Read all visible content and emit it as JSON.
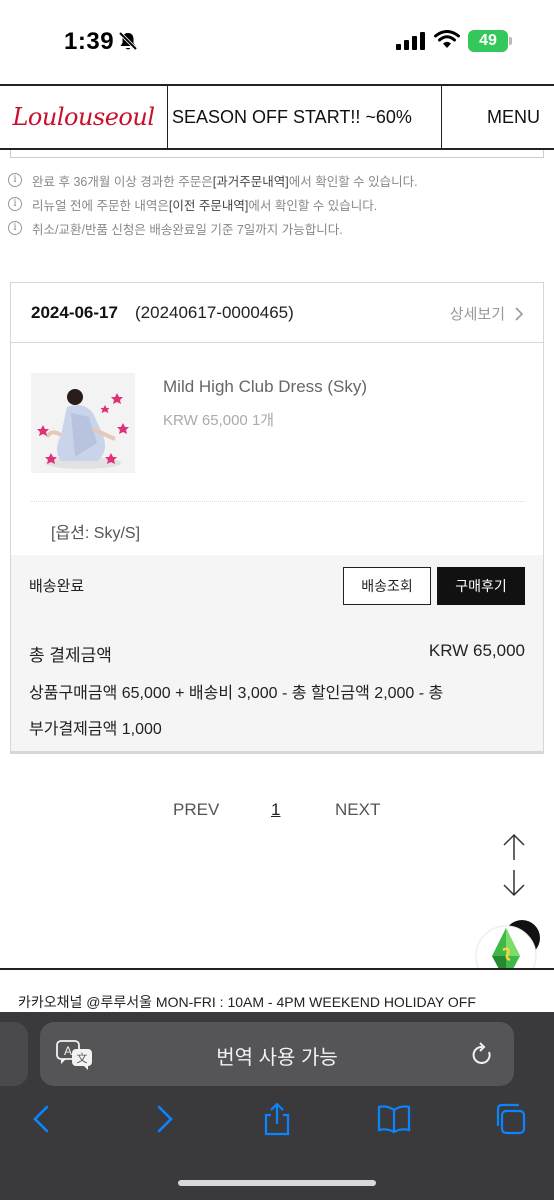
{
  "status_bar": {
    "time": "1:39",
    "battery": "49"
  },
  "header": {
    "logo": "Loulouseoul",
    "promo": "SEASON OFF START!! ~60%",
    "menu": "MENU"
  },
  "notes": [
    {
      "pre": "완료 후 36개월 이상 경과한 주문은 ",
      "link": "[과거주문내역]",
      "post": "에서 확인할 수 있습니다."
    },
    {
      "pre": "리뉴얼 전에 주문한 내역은 ",
      "link": "[이전 주문내역]",
      "post": "에서 확인할 수 있습니다."
    },
    {
      "pre": "취소/교환/반품 신청은 배송완료일 기준 7일까지 가능합니다.",
      "link": "",
      "post": ""
    }
  ],
  "order": {
    "date": "2024-06-17",
    "number": "(20240617-0000465)",
    "detail_link": "상세보기",
    "product_name": "Mild High Club Dress (Sky)",
    "product_price": "KRW 65,000 1개",
    "option": "[옵션: Sky/S]",
    "delivery_status": "배송완료",
    "track_button": "배송조회",
    "review_button": "구매후기",
    "total_label": "총 결제금액",
    "total_value": "KRW 65,000",
    "breakdown_line1": "상품구매금액 65,000 + 배송비 3,000 - 총 할인금액 2,000 - 총",
    "breakdown_line2": "부가결제금액 1,000"
  },
  "pagination": {
    "prev": "PREV",
    "current": "1",
    "next": "NEXT"
  },
  "footer": {
    "text": "카카오채널 @루루서울    MON-FRI : 10AM - 4PM    WEEKEND HOLIDAY OFF"
  },
  "safari": {
    "address_text": "번역 사용 가능"
  },
  "colors": {
    "logo": "#c8102e",
    "battery": "#34c759",
    "safari_blue": "#0a84ff"
  }
}
